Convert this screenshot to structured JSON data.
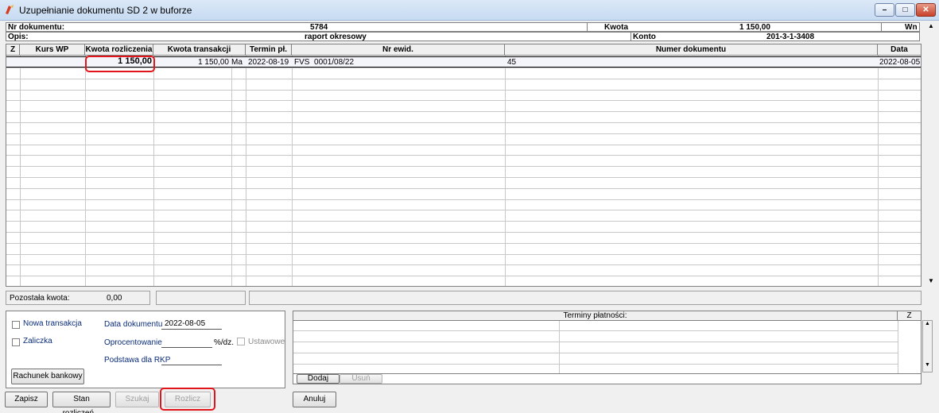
{
  "window": {
    "title": "Uzupełnianie dokumentu SD 2 w buforze"
  },
  "header": {
    "nr_dokumentu_label": "Nr dokumentu:",
    "nr_dokumentu_value": "5784",
    "kwota_label": "Kwota",
    "kwota_value": "1 150,00",
    "wn_label": "Wn",
    "opis_label": "Opis:",
    "opis_value": "raport okresowy",
    "konto_label": "Konto",
    "konto_value": "201-3-1-3408"
  },
  "grid": {
    "columns": [
      "Z",
      "Kurs WP",
      "Kwota rozliczenia",
      "Kwota transakcji",
      "Termin pł.",
      "Nr ewid.",
      "Numer dokumentu",
      "Data"
    ],
    "rows": [
      {
        "z": "",
        "kurs_wp": "",
        "kwota_rozliczenia": "1 150,00",
        "kwota_transakcji": "1 150,00",
        "typ": "Ma",
        "termin": "2022-08-19",
        "nr_ewid": "FVS  0001/08/22",
        "numer_dokumentu": "45",
        "data": "2022-08-05"
      }
    ]
  },
  "status": {
    "pozostala_label": "Pozostała kwota:",
    "pozostala_value": "0,00"
  },
  "form": {
    "nowa_transakcja_label": "Nowa transakcja",
    "zaliczka_label": "Zaliczka",
    "data_dokumentu_label": "Data dokumentu",
    "data_dokumentu_value": "2022-08-05",
    "oprocentowanie_label": "Oprocentowanie",
    "oprocentowanie_unit": "%/dz.",
    "ustawowe_label": "Ustawowe",
    "podstawa_label": "Podstawa dla RKP",
    "rachunek_button": "Rachunek bankowy"
  },
  "terminy": {
    "header": "Terminy płatności:",
    "z_header": "Z",
    "dodaj_button": "Dodaj",
    "usun_button": "Usuń"
  },
  "buttons": {
    "zapisz": "Zapisz",
    "stan": "Stan rozliczeń...",
    "szukaj": "Szukaj",
    "rozlicz": "Rozlicz",
    "anuluj": "Anuluj"
  }
}
